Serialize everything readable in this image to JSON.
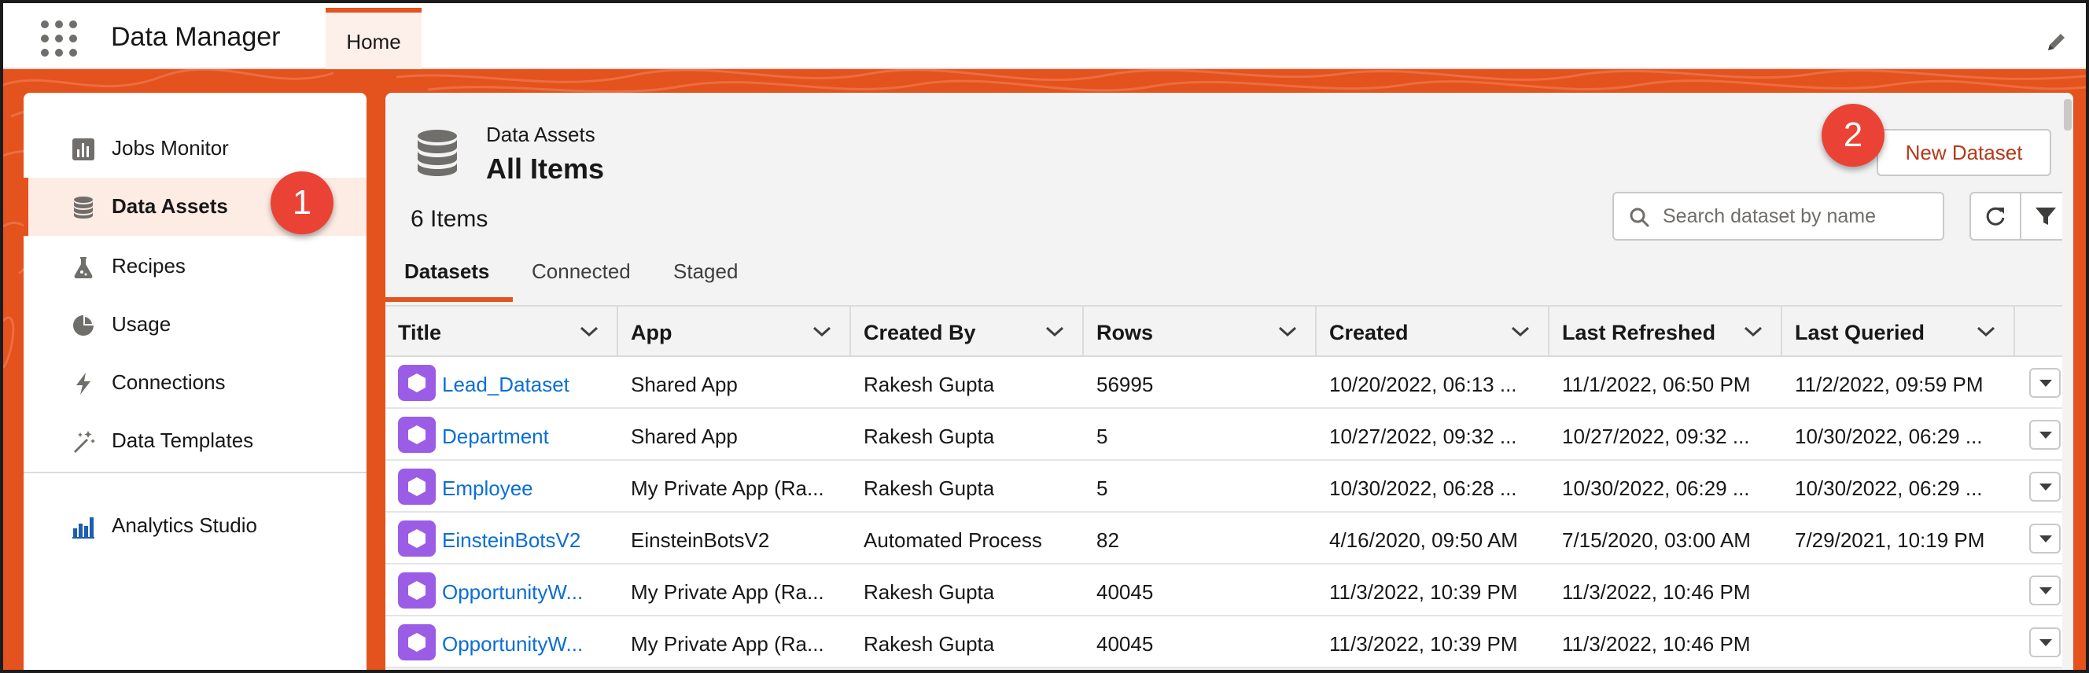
{
  "app": {
    "name": "Data Manager",
    "home_tab": "Home"
  },
  "sidebar": {
    "items": [
      {
        "label": "Jobs Monitor",
        "icon": "bar-chart-icon"
      },
      {
        "label": "Data Assets",
        "icon": "database-icon",
        "active": true
      },
      {
        "label": "Recipes",
        "icon": "flask-icon"
      },
      {
        "label": "Usage",
        "icon": "pie-chart-icon"
      },
      {
        "label": "Connections",
        "icon": "lightning-icon"
      },
      {
        "label": "Data Templates",
        "icon": "magic-wand-icon"
      },
      {
        "label": "Analytics Studio",
        "icon": "analytics-icon"
      }
    ]
  },
  "callouts": {
    "first": "1",
    "second": "2"
  },
  "header": {
    "subtitle": "Data Assets",
    "title": "All Items",
    "item_count": "6 Items",
    "new_button": "New Dataset",
    "search_placeholder": "Search dataset by name"
  },
  "tabs": [
    "Datasets",
    "Connected",
    "Staged"
  ],
  "table": {
    "columns": [
      "Title",
      "App",
      "Created By",
      "Rows",
      "Created",
      "Last Refreshed",
      "Last Queried"
    ],
    "rows": [
      [
        "Lead_Dataset",
        "Shared App",
        "Rakesh Gupta",
        "56995",
        "10/20/2022, 06:13 ...",
        "11/1/2022, 06:50 PM",
        "11/2/2022, 09:59 PM"
      ],
      [
        "Department",
        "Shared App",
        "Rakesh Gupta",
        "5",
        "10/27/2022, 09:32 ...",
        "10/27/2022, 09:32 ...",
        "10/30/2022, 06:29 ..."
      ],
      [
        "Employee",
        "My Private App (Ra...",
        "Rakesh Gupta",
        "5",
        "10/30/2022, 06:28 ...",
        "10/30/2022, 06:29 ...",
        "10/30/2022, 06:29 ..."
      ],
      [
        "EinsteinBotsV2",
        "EinsteinBotsV2",
        "Automated Process",
        "82",
        "4/16/2020, 09:50 AM",
        "7/15/2020, 03:00 AM",
        "7/29/2021, 10:19 PM"
      ],
      [
        "OpportunityW...",
        "My Private App (Ra...",
        "Rakesh Gupta",
        "40045",
        "11/3/2022, 10:39 PM",
        "11/3/2022, 10:46 PM",
        ""
      ],
      [
        "OpportunityW...",
        "My Private App (Ra...",
        "Rakesh Gupta",
        "40045",
        "11/3/2022, 10:39 PM",
        "11/3/2022, 10:46 PM",
        ""
      ]
    ]
  },
  "colors": {
    "brand": "#e4521e",
    "link": "#0b6ed4",
    "dataset_icon": "#9b5de5",
    "callout": "#ea4335"
  }
}
